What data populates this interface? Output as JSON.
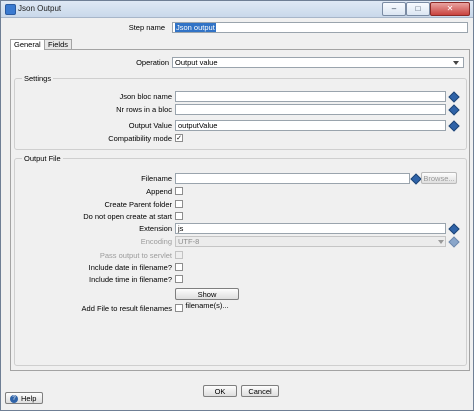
{
  "window": {
    "title": "Json Output",
    "minimize_glyph": "–",
    "maximize_glyph": "□",
    "close_glyph": "✕"
  },
  "step": {
    "label": "Step name",
    "value": "Json output"
  },
  "tabs": [
    {
      "label": "General",
      "active": true
    },
    {
      "label": "Fields",
      "active": false
    }
  ],
  "operation": {
    "label": "Operation",
    "value": "Output value"
  },
  "settings": {
    "title": "Settings",
    "json_bloc_name": {
      "label": "Json bloc name",
      "value": ""
    },
    "nr_rows_in_bloc": {
      "label": "Nr rows in a bloc",
      "value": ""
    },
    "output_value": {
      "label": "Output Value",
      "value": "outputValue"
    },
    "compatibility_mode": {
      "label": "Compatibility mode",
      "checked": true
    }
  },
  "output_file": {
    "title": "Output File",
    "filename": {
      "label": "Filename",
      "value": ""
    },
    "browse_label": "Browse...",
    "append": {
      "label": "Append",
      "checked": false
    },
    "create_parent_folder": {
      "label": "Create Parent folder",
      "checked": false
    },
    "do_not_open_create_at_start": {
      "label": "Do not open create at start",
      "checked": false
    },
    "extension": {
      "label": "Extension",
      "value": "js"
    },
    "encoding": {
      "label": "Encoding",
      "value": "UTF-8"
    },
    "pass_output_to_servlet": {
      "label": "Pass output to servlet",
      "checked": false
    },
    "include_date": {
      "label": "Include date in filename?",
      "checked": false
    },
    "include_time": {
      "label": "Include time in filename?",
      "checked": false
    },
    "show_filenames_label": "Show filename(s)...",
    "add_file_to_result": {
      "label": "Add File to result filenames",
      "checked": false
    }
  },
  "footer": {
    "ok_label": "OK",
    "cancel_label": "Cancel",
    "help_label": "Help"
  },
  "check_glyph": "✓",
  "colors": {
    "selection": "#3173c6",
    "variable_icon": "#2f63a8"
  }
}
